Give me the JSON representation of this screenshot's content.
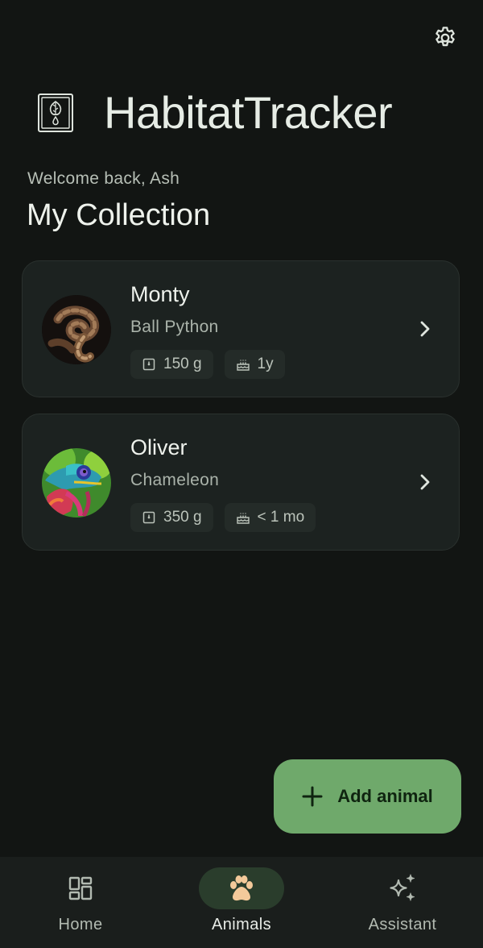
{
  "app": {
    "title": "HabitatTracker"
  },
  "header": {
    "welcome": "Welcome back, Ash",
    "section_title": "My Collection"
  },
  "animals": [
    {
      "name": "Monty",
      "species": "Ball Python",
      "weight": "150 g",
      "age": "1y"
    },
    {
      "name": "Oliver",
      "species": "Chameleon",
      "weight": "350 g",
      "age": "< 1 mo"
    }
  ],
  "fab": {
    "label": "Add animal"
  },
  "nav": {
    "items": [
      {
        "label": "Home",
        "icon": "dashboard-icon",
        "active": false
      },
      {
        "label": "Animals",
        "icon": "paw-icon",
        "active": true
      },
      {
        "label": "Assistant",
        "icon": "sparkle-icon",
        "active": false
      }
    ]
  },
  "colors": {
    "background": "#121513",
    "card": "#1c2220",
    "accent": "#6fa96b",
    "paw": "#f3c99a",
    "active_nav": "#2a3d2c"
  }
}
